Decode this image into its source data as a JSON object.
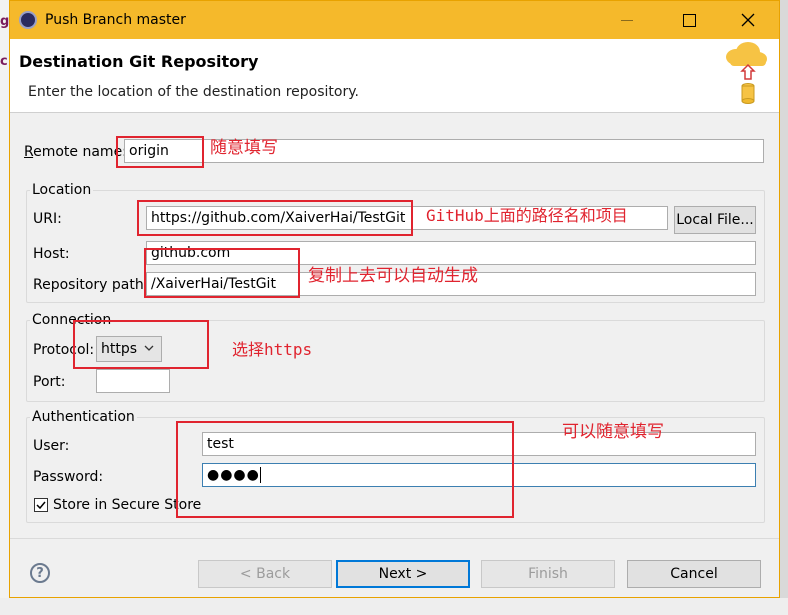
{
  "window": {
    "title": "Push Branch master"
  },
  "banner": {
    "title": "Destination Git Repository",
    "description": "Enter the location of the destination repository."
  },
  "remote": {
    "label_first": "R",
    "label_rest": "emote name:",
    "value": "origin"
  },
  "location": {
    "group_title": "Location",
    "uri_label": "URI:",
    "uri_value": "https://github.com/XaiverHai/TestGit",
    "local_file_button": "Local File...",
    "host_label": "Host:",
    "host_value": "github.com",
    "repo_path_label": "Repository path:",
    "repo_path_value": "/XaiverHai/TestGit"
  },
  "connection": {
    "group_title": "Connection",
    "protocol_label": "Protocol:",
    "protocol_value": "https",
    "port_label": "Port:",
    "port_value": ""
  },
  "authentication": {
    "group_title": "Authentication",
    "user_label": "User:",
    "user_value": "test",
    "password_label": "Password:",
    "password_value": "●●●●",
    "store_label": "Store in Secure Store",
    "store_checked": true
  },
  "buttons": {
    "back": "< Back",
    "next": "Next >",
    "finish": "Finish",
    "cancel": "Cancel"
  },
  "annotations": {
    "remote_note": "随意填写",
    "uri_note": "GitHub上面的路径名和项目",
    "copy_note": "复制上去可以自动生成",
    "protocol_note": "选择https",
    "auth_note": "可以随意填写"
  },
  "colors": {
    "titlebar": "#f5b92b",
    "annotation": "#e0242f",
    "focus": "#0078d7"
  },
  "icons": {
    "app": "eclipse-icon",
    "banner": "cloud-upload-icon",
    "help": "help-icon"
  }
}
